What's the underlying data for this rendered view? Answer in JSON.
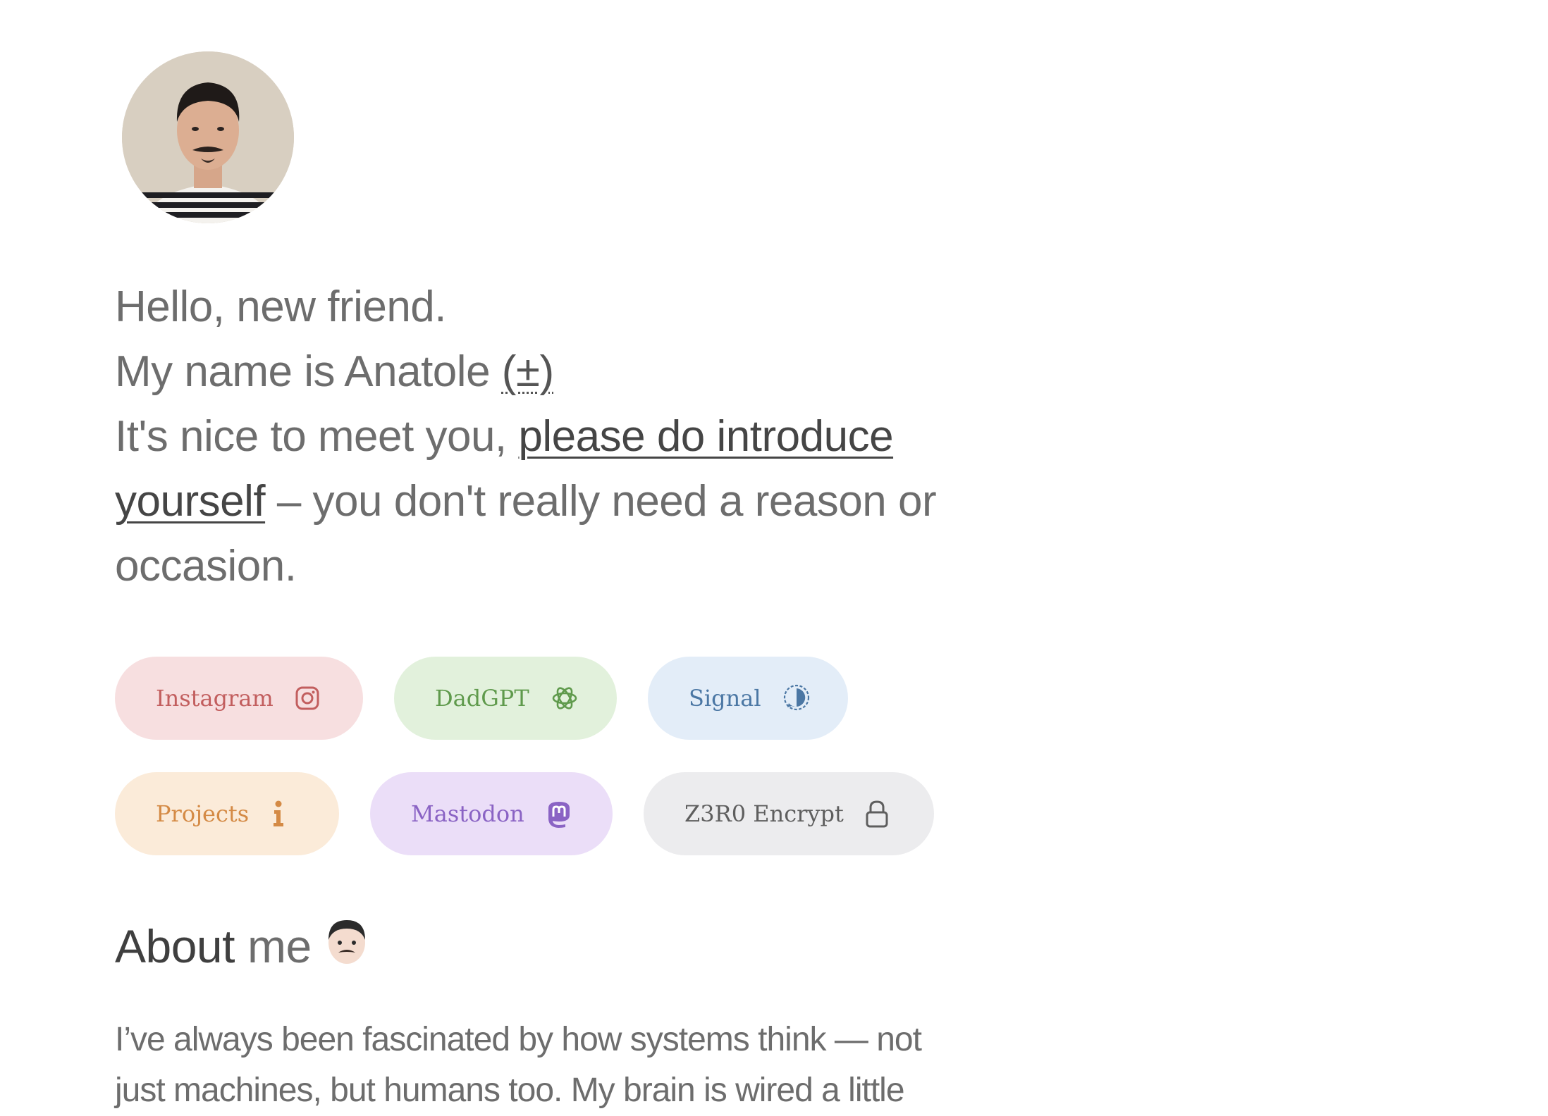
{
  "intro": {
    "greeting": "Hello, new friend.",
    "name_prefix": "My name is Anatole ",
    "name_toggle": "(±)",
    "meet_prefix": "It's nice to meet you, ",
    "meet_link_1": "please do introduce",
    "meet_link_2": "yourself",
    "meet_suffix": " – you don't really need a reason or",
    "meet_end": "occasion."
  },
  "links": [
    {
      "label": "Instagram",
      "icon": "instagram-icon",
      "bg": "#f7dfe0",
      "fg": "#c25e5e"
    },
    {
      "label": "DadGPT",
      "icon": "openai-icon",
      "bg": "#e2f1dc",
      "fg": "#5f9a4c"
    },
    {
      "label": "Signal",
      "icon": "signal-icon",
      "bg": "#e3edf8",
      "fg": "#4b77a4"
    },
    {
      "label": "Projects",
      "icon": "info-icon",
      "bg": "#fbebd9",
      "fg": "#d48a45"
    },
    {
      "label": "Mastodon",
      "icon": "mastodon-icon",
      "bg": "#ebdef8",
      "fg": "#8a63c4"
    },
    {
      "label": "Z3R0 Encrypt",
      "icon": "lock-icon",
      "bg": "#ececee",
      "fg": "#5e5e5e"
    }
  ],
  "about": {
    "title_bold": "About",
    "title_light": "me",
    "emoji": "👨🏻",
    "para_line_1": "I’ve always been fascinated by how systems think — not",
    "para_line_2": "just machines, but humans too. My brain is wired a little"
  }
}
